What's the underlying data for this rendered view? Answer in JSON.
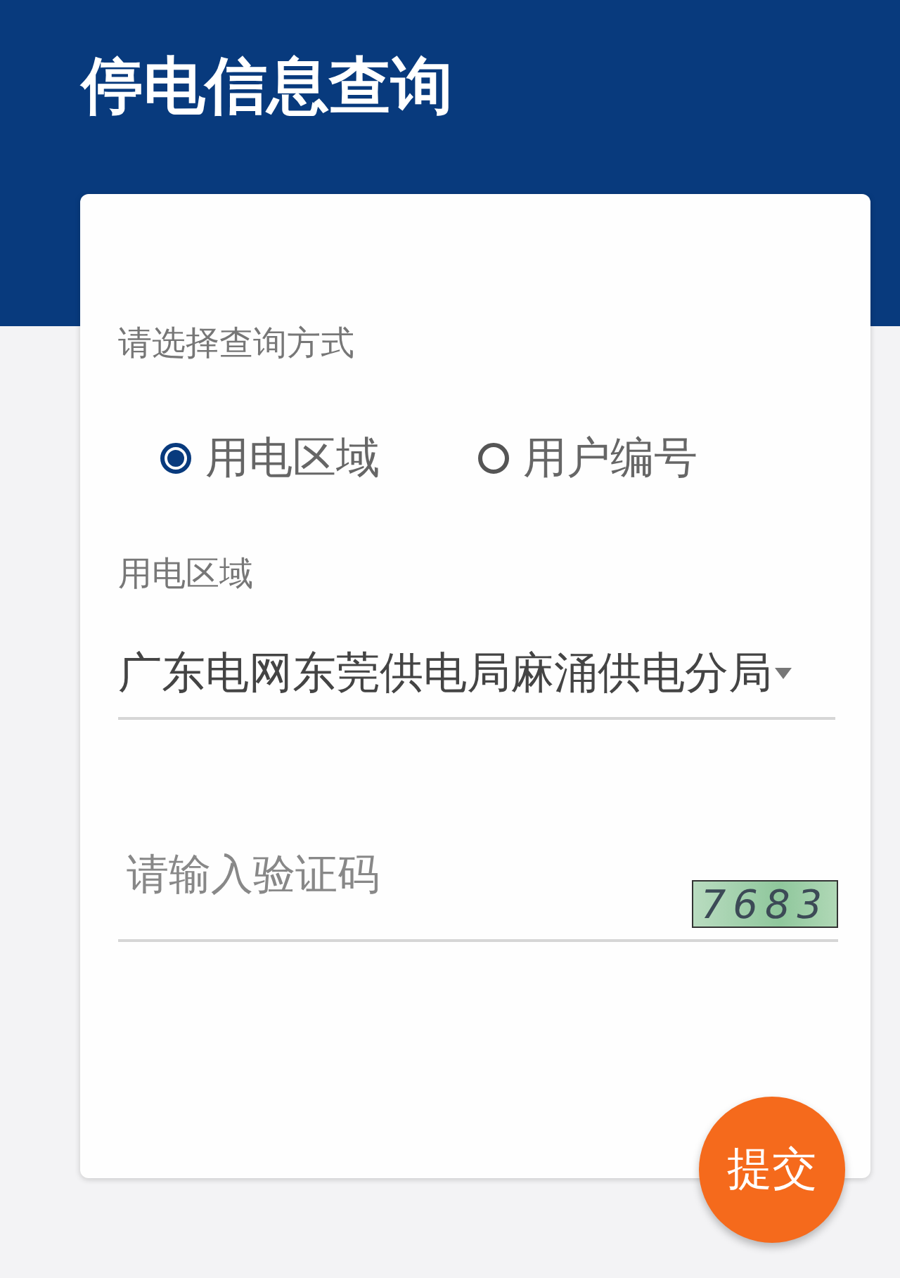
{
  "header": {
    "title": "停电信息查询"
  },
  "form": {
    "mode_label": "请选择查询方式",
    "modes": [
      {
        "label": "用电区域",
        "selected": true
      },
      {
        "label": "用户编号",
        "selected": false
      }
    ],
    "region_label": "用电区域",
    "region_value": "广东电网东莞供电局麻涌供电分局",
    "captcha_placeholder": "请输入验证码",
    "captcha_code": "7683"
  },
  "submit": "提交"
}
